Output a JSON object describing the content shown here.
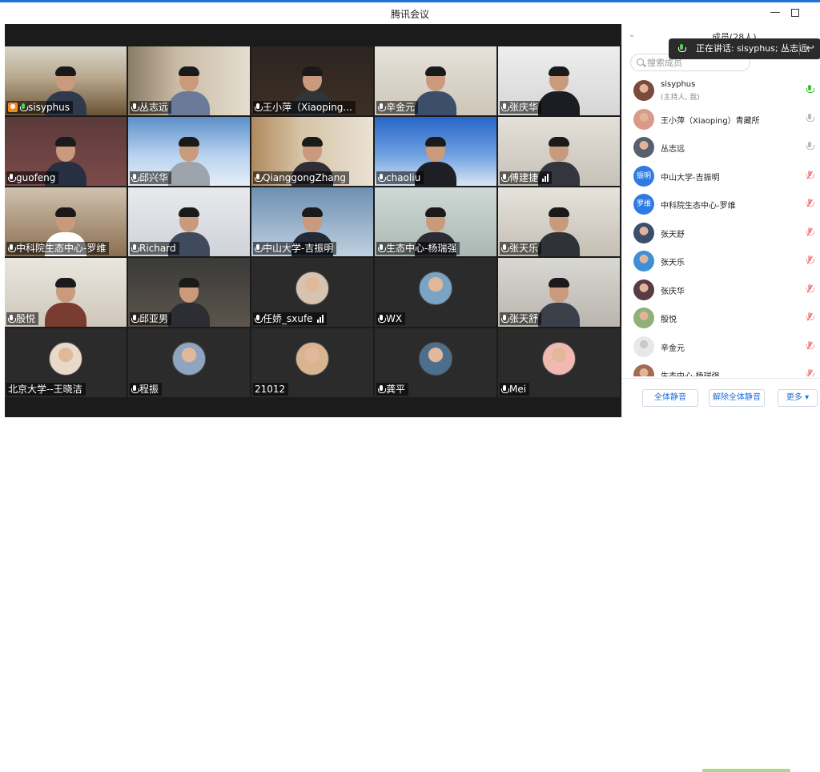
{
  "window": {
    "title": "腾讯会议"
  },
  "panel": {
    "member_count": "成员(28人)",
    "speaking": "正在讲话: sisyphus; 丛志远;",
    "search_placeholder": "搜索成员",
    "members": [
      {
        "name": "sisyphus",
        "sub": "(主持人, 我)",
        "mic": "on",
        "avatar": "photo"
      },
      {
        "name": "王小萍（Xiaoping）青藏所",
        "mic": "idle",
        "avatar": "photo"
      },
      {
        "name": "丛志远",
        "mic": "idle",
        "avatar": "photo"
      },
      {
        "name": "中山大学-吉振明",
        "mic": "muted",
        "avatar": "text",
        "avatar_text": "振明"
      },
      {
        "name": "中科院生态中心-罗维",
        "mic": "muted",
        "avatar": "text",
        "avatar_text": "罗维"
      },
      {
        "name": "张天舒",
        "mic": "muted",
        "avatar": "photo"
      },
      {
        "name": "张天乐",
        "mic": "muted",
        "avatar": "photo"
      },
      {
        "name": "张庆华",
        "mic": "muted",
        "avatar": "photo"
      },
      {
        "name": "殷悦",
        "mic": "muted",
        "avatar": "photo"
      },
      {
        "name": "辛金元",
        "mic": "muted",
        "avatar": "default"
      },
      {
        "name": "生态中心-杨瑞强",
        "mic": "muted",
        "avatar": "photo"
      }
    ],
    "buttons": {
      "mute_all": "全体静音",
      "unmute_all": "解除全体静音",
      "more": "更多 ▾"
    }
  },
  "tiles": [
    {
      "label": "sisyphus",
      "host": true,
      "mic": "green"
    },
    {
      "label": "丛志远",
      "mic": "on"
    },
    {
      "label": "王小萍（Xiaoping...",
      "mic": "on"
    },
    {
      "label": "辛金元",
      "mic": "muted"
    },
    {
      "label": "张庆华",
      "mic": "muted"
    },
    {
      "label": "guofeng",
      "mic": "muted"
    },
    {
      "label": "邱兴华",
      "mic": "muted"
    },
    {
      "label": "QianggongZhang",
      "mic": "muted"
    },
    {
      "label": "chaoliu",
      "mic": "muted"
    },
    {
      "label": "傅建捷",
      "mic": "muted",
      "signal": true
    },
    {
      "label": "中科院生态中心-罗维",
      "mic": "muted"
    },
    {
      "label": "Richard",
      "mic": "muted"
    },
    {
      "label": "中山大学-吉振明",
      "mic": "muted"
    },
    {
      "label": "生态中心-杨瑞强",
      "mic": "muted"
    },
    {
      "label": "张天乐",
      "mic": "muted"
    },
    {
      "label": "殷悦",
      "mic": "muted"
    },
    {
      "label": "邱亚男",
      "mic": "muted"
    },
    {
      "label": "任娇_sxufe",
      "mic": "muted",
      "signal": true
    },
    {
      "label": "WX",
      "mic": "muted"
    },
    {
      "label": "张天舒",
      "mic": "muted"
    },
    {
      "label": "北京大学--王晓洁",
      "mic": "none"
    },
    {
      "label": "程振",
      "mic": "muted"
    },
    {
      "label": "21012",
      "mic": "none"
    },
    {
      "label": "龚平",
      "mic": "muted"
    },
    {
      "label": "Mei",
      "mic": "muted"
    }
  ],
  "colors": {
    "accent": "#1f6fd6",
    "speaking_green": "#3dc13d",
    "muted_red": "#e54c4c",
    "host_orange": "#f58a1f"
  }
}
